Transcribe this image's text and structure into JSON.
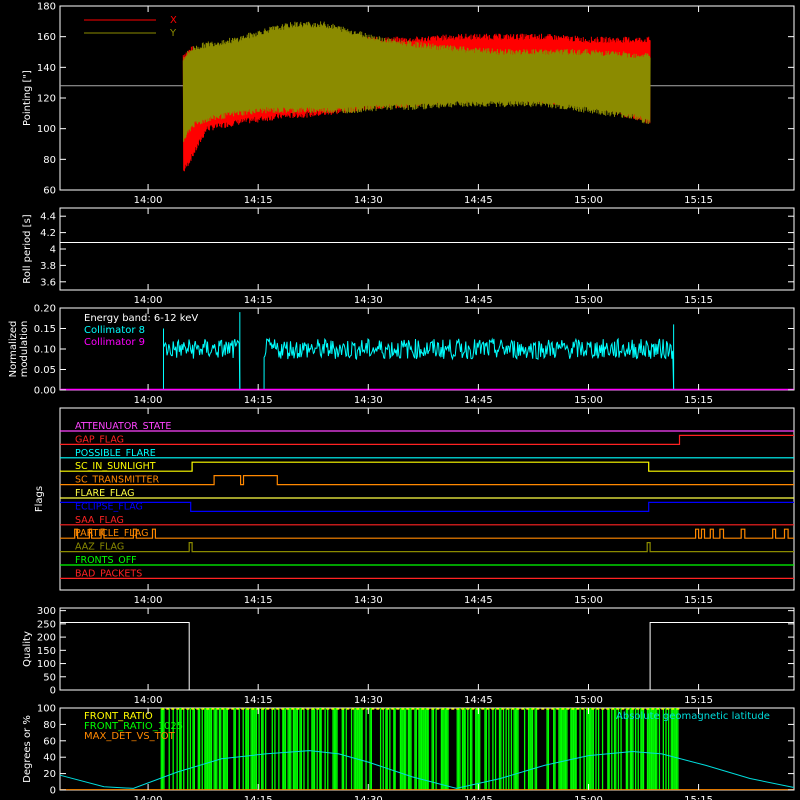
{
  "colors": {
    "x": "#ff0000",
    "y": "#8b8b00",
    "roll": "#ffffff",
    "coll8": "#00ffff",
    "coll9": "#ff00ff",
    "front_ratio": "#ffff00",
    "front_ratio_1025": "#00ff00",
    "max_det": "#ff8800",
    "geomag": "#00dddd"
  },
  "time_axis": {
    "tick_labels": [
      "14:00",
      "14:15",
      "14:30",
      "14:45",
      "15:00",
      "15:15"
    ],
    "tick_minutes": [
      840,
      855,
      870,
      885,
      900,
      915
    ],
    "range_minutes": [
      828,
      928
    ]
  },
  "chart_data": [
    {
      "type": "line",
      "ylabel": "Pointing [\"]",
      "ylim": [
        60,
        180
      ],
      "yticks": [
        60,
        80,
        100,
        120,
        140,
        160,
        180
      ],
      "reference_value": 128,
      "data_minutes": [
        844.8,
        908.4
      ],
      "series": [
        {
          "name": "X",
          "color": "#ff0000",
          "envelope_t": [
            844.8,
            846,
            848,
            852,
            858,
            864,
            870,
            876,
            882,
            888,
            894,
            900,
            906,
            908.4
          ],
          "upper": [
            148,
            152,
            150,
            152,
            158,
            160,
            158,
            158,
            160,
            160,
            160,
            158,
            158,
            158
          ],
          "lower": [
            72,
            82,
            100,
            104,
            108,
            110,
            114,
            116,
            118,
            120,
            118,
            116,
            108,
            104
          ]
        },
        {
          "name": "Y",
          "color": "#8b8b00",
          "envelope_t": [
            844.8,
            846,
            848,
            852,
            856,
            860,
            864,
            868,
            872,
            876,
            882,
            888,
            894,
            900,
            906,
            908.4
          ],
          "upper": [
            146,
            152,
            155,
            158,
            164,
            168,
            168,
            163,
            158,
            155,
            152,
            150,
            150,
            150,
            148,
            148
          ],
          "lower": [
            92,
            102,
            106,
            110,
            112,
            112,
            112,
            112,
            114,
            114,
            116,
            116,
            116,
            112,
            108,
            104
          ]
        }
      ]
    },
    {
      "type": "line",
      "ylabel": "Roll period [s]",
      "ylim": [
        3.5,
        4.5
      ],
      "yticks": [
        3.6,
        3.8,
        4.0,
        4.2,
        4.4
      ],
      "series": [
        {
          "name": "",
          "color": "#ffffff",
          "x": [
            828,
            928
          ],
          "y": [
            4.08,
            4.08
          ]
        }
      ]
    },
    {
      "type": "line",
      "ylabel": "Normalized modulation",
      "ylim": [
        0,
        0.2
      ],
      "yticks": [
        0.0,
        0.05,
        0.1,
        0.15,
        0.2
      ],
      "ytick_labels": [
        "0.00",
        "0.05",
        "0.10",
        "0.15",
        "0.20"
      ],
      "annotation": "Energy band: 6-12 keV",
      "segments_minutes": [
        [
          842.1,
          852.5
        ],
        [
          855.8,
          911.6
        ]
      ],
      "level_mean": 0.1,
      "spikes": [
        {
          "t": 852.5,
          "y": 0.19
        },
        {
          "t": 842.1,
          "y": 0.15
        },
        {
          "t": 911.6,
          "y": 0.16
        }
      ],
      "series": [
        {
          "name": "Collimator 8",
          "color": "#00ffff"
        },
        {
          "name": "Collimator 9",
          "color": "#ff00ff",
          "constant": 0.0
        }
      ]
    },
    {
      "type": "line",
      "ylabel": "Flags",
      "flags": [
        {
          "name": "ATTENUATOR_STATE",
          "color": "#ff44ff",
          "steps": [
            [
              828,
              0
            ],
            [
              928,
              0
            ]
          ]
        },
        {
          "name": "GAP_FLAG",
          "color": "#ff2222",
          "steps": [
            [
              828,
              0
            ],
            [
              912.4,
              1
            ],
            [
              928,
              1
            ]
          ]
        },
        {
          "name": "POSSIBLE_FLARE",
          "color": "#00ffff",
          "steps": [
            [
              828,
              0
            ],
            [
              928,
              0
            ]
          ]
        },
        {
          "name": "SC_IN_SUNLIGHT",
          "color": "#ffff00",
          "steps": [
            [
              828,
              0
            ],
            [
              846,
              1
            ],
            [
              908.2,
              0
            ],
            [
              928,
              0
            ]
          ]
        },
        {
          "name": "SC_TRANSMITTER",
          "color": "#ff8800",
          "steps": [
            [
              828,
              0
            ],
            [
              849,
              1
            ],
            [
              852.6,
              0
            ],
            [
              853,
              1
            ],
            [
              857.6,
              0
            ],
            [
              928,
              0
            ]
          ]
        },
        {
          "name": "FLARE_FLAG",
          "color": "#ffff44",
          "steps": [
            [
              828,
              0
            ],
            [
              928,
              0
            ]
          ]
        },
        {
          "name": "ECLIPSE_FLAG",
          "color": "#0000ff",
          "steps": [
            [
              828,
              1
            ],
            [
              845.8,
              0
            ],
            [
              908.2,
              1
            ],
            [
              928,
              1
            ]
          ]
        },
        {
          "name": "SAA_FLAG",
          "color": "#ff2222",
          "steps": [
            [
              828,
              0
            ],
            [
              928,
              0
            ]
          ]
        },
        {
          "name": "PARTICLE_FLAG",
          "color": "#ff8800",
          "steps": [
            [
              828,
              0
            ],
            [
              830,
              1
            ],
            [
              830.4,
              0
            ],
            [
              832,
              1
            ],
            [
              832.3,
              0
            ],
            [
              833.6,
              1
            ],
            [
              834,
              0
            ],
            [
              838,
              1
            ],
            [
              838.4,
              0
            ],
            [
              840.6,
              1
            ],
            [
              841,
              0
            ],
            [
              914.6,
              1
            ],
            [
              915,
              0
            ],
            [
              915.4,
              1
            ],
            [
              915.8,
              0
            ],
            [
              916.6,
              1
            ],
            [
              917,
              0
            ],
            [
              917.9,
              1
            ],
            [
              918.4,
              0
            ],
            [
              920.8,
              1
            ],
            [
              921.3,
              0
            ],
            [
              925.1,
              1
            ],
            [
              925.5,
              0
            ],
            [
              926.7,
              1
            ],
            [
              927.2,
              0
            ]
          ]
        },
        {
          "name": "AAZ_FLAG",
          "color": "#8b8b00",
          "steps": [
            [
              828,
              0
            ],
            [
              845.6,
              1
            ],
            [
              846,
              0
            ],
            [
              908,
              1
            ],
            [
              908.4,
              0
            ],
            [
              928,
              0
            ]
          ]
        },
        {
          "name": "FRONTS_OFF",
          "color": "#00ff00",
          "steps": [
            [
              828,
              0
            ],
            [
              928,
              0
            ]
          ]
        },
        {
          "name": "BAD_PACKETS",
          "color": "#ff2222",
          "steps": [
            [
              828,
              0
            ],
            [
              928,
              0
            ]
          ]
        }
      ]
    },
    {
      "type": "line",
      "ylabel": "Quality",
      "ylim": [
        0,
        310
      ],
      "yticks": [
        0,
        50,
        100,
        150,
        200,
        250,
        300
      ],
      "series": [
        {
          "name": "",
          "color": "#ffffff",
          "x": [
            828,
            845.6,
            845.6,
            908.4,
            908.4,
            928
          ],
          "y": [
            255,
            255,
            0,
            0,
            255,
            255
          ]
        }
      ]
    },
    {
      "type": "line",
      "ylabel": "Degrees or %",
      "ylim": [
        0,
        100
      ],
      "yticks": [
        0,
        20,
        40,
        60,
        80,
        100
      ],
      "series": [
        {
          "name": "FRONT_RATIO",
          "color": "#ffff00"
        },
        {
          "name": "FRONT_RATIO_1025",
          "color": "#00ff00",
          "active_minutes": [
            841.8,
            912.4
          ]
        },
        {
          "name": "MAX_DET_VS_TOT",
          "color": "#ff8800"
        },
        {
          "name": "Absolute geomagnetic latitude",
          "color": "#00dddd",
          "x": [
            828,
            834,
            838,
            844,
            850,
            856,
            862,
            866,
            870,
            876,
            882,
            888,
            894,
            900,
            906,
            910,
            916,
            922,
            928
          ],
          "y": [
            18,
            4,
            2,
            22,
            38,
            44,
            48,
            44,
            34,
            16,
            2,
            14,
            30,
            42,
            47,
            44,
            30,
            14,
            3
          ]
        }
      ]
    }
  ]
}
